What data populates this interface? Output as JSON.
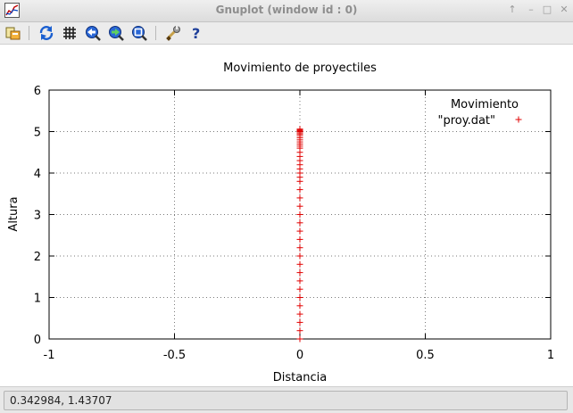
{
  "window": {
    "title": "Gnuplot (window id : 0)",
    "controls": {
      "up_glyph": "↑",
      "minimize_glyph": "–",
      "maximize_glyph": "□",
      "close_glyph": "✕"
    }
  },
  "toolbar": {
    "items": [
      {
        "name": "export-icon"
      },
      {
        "name": "replot-icon"
      },
      {
        "name": "grid-icon"
      },
      {
        "name": "previous-zoom-icon"
      },
      {
        "name": "next-zoom-icon"
      },
      {
        "name": "autoscale-icon"
      },
      {
        "name": "settings-icon"
      },
      {
        "name": "help-icon"
      }
    ]
  },
  "status": {
    "coordinates": "0.342984,  1.43707"
  },
  "colors": {
    "series": "#e00000",
    "grid": "#7a7a7a",
    "axis": "#000000"
  },
  "chart_data": {
    "type": "scatter",
    "title": "Movimiento de proyectiles",
    "xlabel": "Distancia",
    "ylabel": "Altura",
    "xlim": [
      -1,
      1
    ],
    "ylim": [
      0,
      6
    ],
    "x_ticks": [
      -1,
      -0.5,
      0,
      0.5,
      1
    ],
    "x_tick_labels": [
      "-1",
      "-0.5",
      "0",
      "0.5",
      "1"
    ],
    "y_ticks": [
      0,
      1,
      2,
      3,
      4,
      5,
      6
    ],
    "y_tick_labels": [
      "0",
      "1",
      "2",
      "3",
      "4",
      "5",
      "6"
    ],
    "grid": true,
    "legend": {
      "title": "Movimiento",
      "position": "top-right"
    },
    "series": [
      {
        "name": "\"proy.dat\"",
        "marker": "+",
        "color": "#e00000",
        "x": [
          0,
          0,
          0,
          0,
          0,
          0,
          0,
          0,
          0,
          0,
          0,
          0,
          0,
          0,
          0,
          0,
          0,
          0,
          0,
          0,
          0,
          0,
          0,
          0,
          0,
          0,
          0,
          0,
          0,
          0,
          0,
          0,
          0,
          0,
          0,
          0,
          0,
          0,
          0,
          0
        ],
        "y": [
          0.0,
          0.2,
          0.4,
          0.6,
          0.8,
          1.0,
          1.2,
          1.4,
          1.6,
          1.8,
          2.0,
          2.2,
          2.4,
          2.6,
          2.8,
          3.0,
          3.2,
          3.4,
          3.6,
          3.8,
          3.9,
          4.0,
          4.1,
          4.2,
          4.3,
          4.4,
          4.5,
          4.6,
          4.65,
          4.7,
          4.75,
          4.8,
          4.85,
          4.9,
          4.94,
          4.97,
          5.0,
          5.02,
          5.04,
          5.06
        ]
      }
    ]
  }
}
